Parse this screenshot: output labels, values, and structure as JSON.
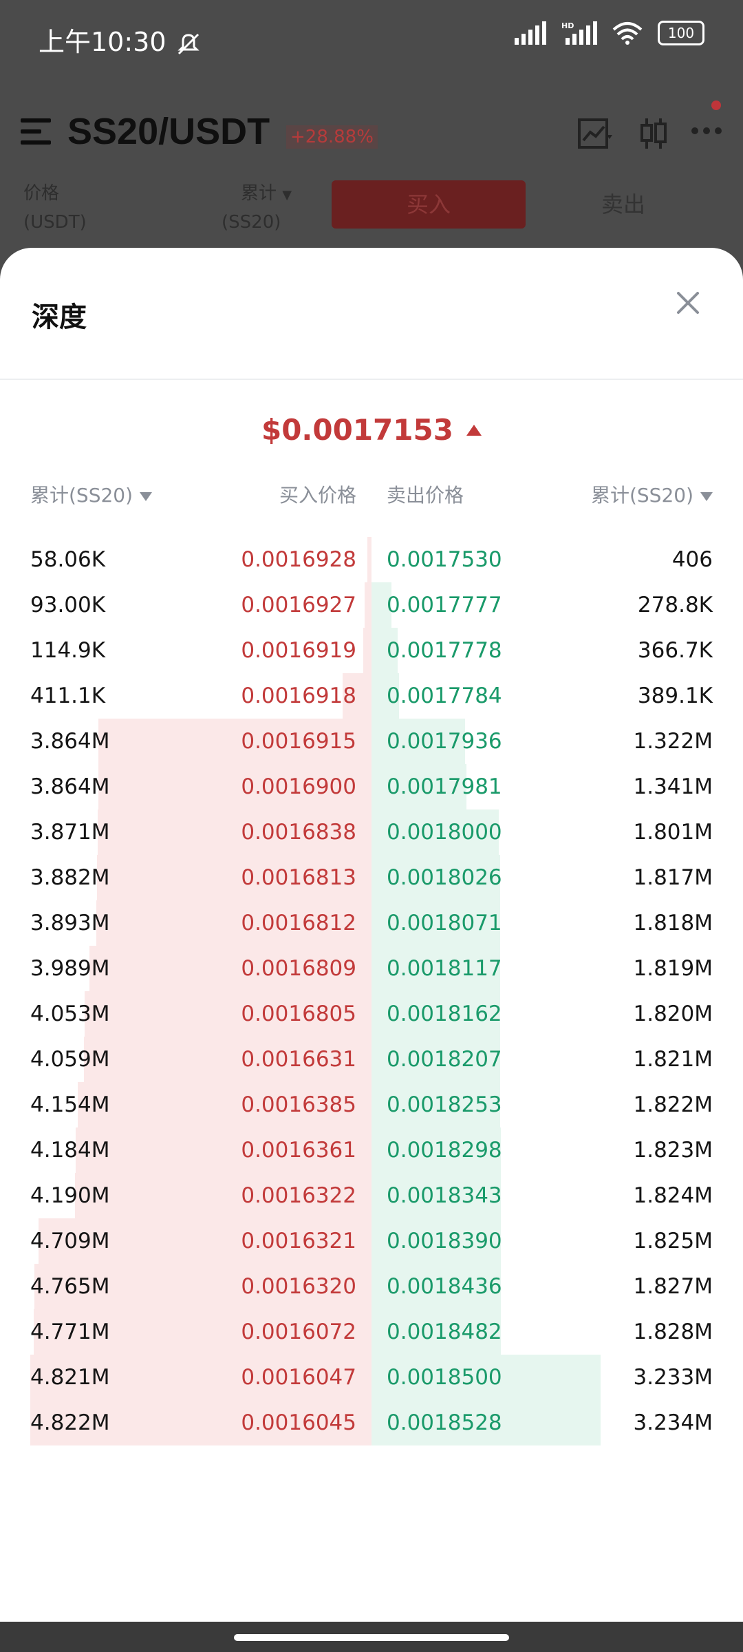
{
  "status": {
    "time": "上午10:30",
    "battery": "100"
  },
  "background_app": {
    "pair": "SS20/USDT",
    "change": "+28.88%",
    "price_label": "价格",
    "price_unit": "(USDT)",
    "cum_label": "累计",
    "cum_unit": "(SS20)",
    "buy_label": "买入",
    "sell_label": "卖出"
  },
  "sheet": {
    "title": "深度",
    "current_price": "$0.0017153",
    "headers": {
      "bid_cum": "累计(SS20)",
      "bid_price": "买入价格",
      "ask_price": "卖出价格",
      "ask_cum": "累计(SS20)"
    },
    "rows": [
      {
        "bid_cum": "58.06K",
        "bid_price": "0.0016928",
        "ask_price": "0.0017530",
        "ask_cum": "406"
      },
      {
        "bid_cum": "93.00K",
        "bid_price": "0.0016927",
        "ask_price": "0.0017777",
        "ask_cum": "278.8K"
      },
      {
        "bid_cum": "114.9K",
        "bid_price": "0.0016919",
        "ask_price": "0.0017778",
        "ask_cum": "366.7K"
      },
      {
        "bid_cum": "411.1K",
        "bid_price": "0.0016918",
        "ask_price": "0.0017784",
        "ask_cum": "389.1K"
      },
      {
        "bid_cum": "3.864M",
        "bid_price": "0.0016915",
        "ask_price": "0.0017936",
        "ask_cum": "1.322M"
      },
      {
        "bid_cum": "3.864M",
        "bid_price": "0.0016900",
        "ask_price": "0.0017981",
        "ask_cum": "1.341M"
      },
      {
        "bid_cum": "3.871M",
        "bid_price": "0.0016838",
        "ask_price": "0.0018000",
        "ask_cum": "1.801M"
      },
      {
        "bid_cum": "3.882M",
        "bid_price": "0.0016813",
        "ask_price": "0.0018026",
        "ask_cum": "1.817M"
      },
      {
        "bid_cum": "3.893M",
        "bid_price": "0.0016812",
        "ask_price": "0.0018071",
        "ask_cum": "1.818M"
      },
      {
        "bid_cum": "3.989M",
        "bid_price": "0.0016809",
        "ask_price": "0.0018117",
        "ask_cum": "1.819M"
      },
      {
        "bid_cum": "4.053M",
        "bid_price": "0.0016805",
        "ask_price": "0.0018162",
        "ask_cum": "1.820M"
      },
      {
        "bid_cum": "4.059M",
        "bid_price": "0.0016631",
        "ask_price": "0.0018207",
        "ask_cum": "1.821M"
      },
      {
        "bid_cum": "4.154M",
        "bid_price": "0.0016385",
        "ask_price": "0.0018253",
        "ask_cum": "1.822M"
      },
      {
        "bid_cum": "4.184M",
        "bid_price": "0.0016361",
        "ask_price": "0.0018298",
        "ask_cum": "1.823M"
      },
      {
        "bid_cum": "4.190M",
        "bid_price": "0.0016322",
        "ask_price": "0.0018343",
        "ask_cum": "1.824M"
      },
      {
        "bid_cum": "4.709M",
        "bid_price": "0.0016321",
        "ask_price": "0.0018390",
        "ask_cum": "1.825M"
      },
      {
        "bid_cum": "4.765M",
        "bid_price": "0.0016320",
        "ask_price": "0.0018436",
        "ask_cum": "1.827M"
      },
      {
        "bid_cum": "4.771M",
        "bid_price": "0.0016072",
        "ask_price": "0.0018482",
        "ask_cum": "1.828M"
      },
      {
        "bid_cum": "4.821M",
        "bid_price": "0.0016047",
        "ask_price": "0.0018500",
        "ask_cum": "3.233M"
      },
      {
        "bid_cum": "4.822M",
        "bid_price": "0.0016045",
        "ask_price": "0.0018528",
        "ask_cum": "3.234M"
      }
    ]
  },
  "colors": {
    "bid": "#c23a3a",
    "ask": "#1a9a6a",
    "bid_fill": "#fbe8e8",
    "ask_fill": "#e6f6ef"
  }
}
